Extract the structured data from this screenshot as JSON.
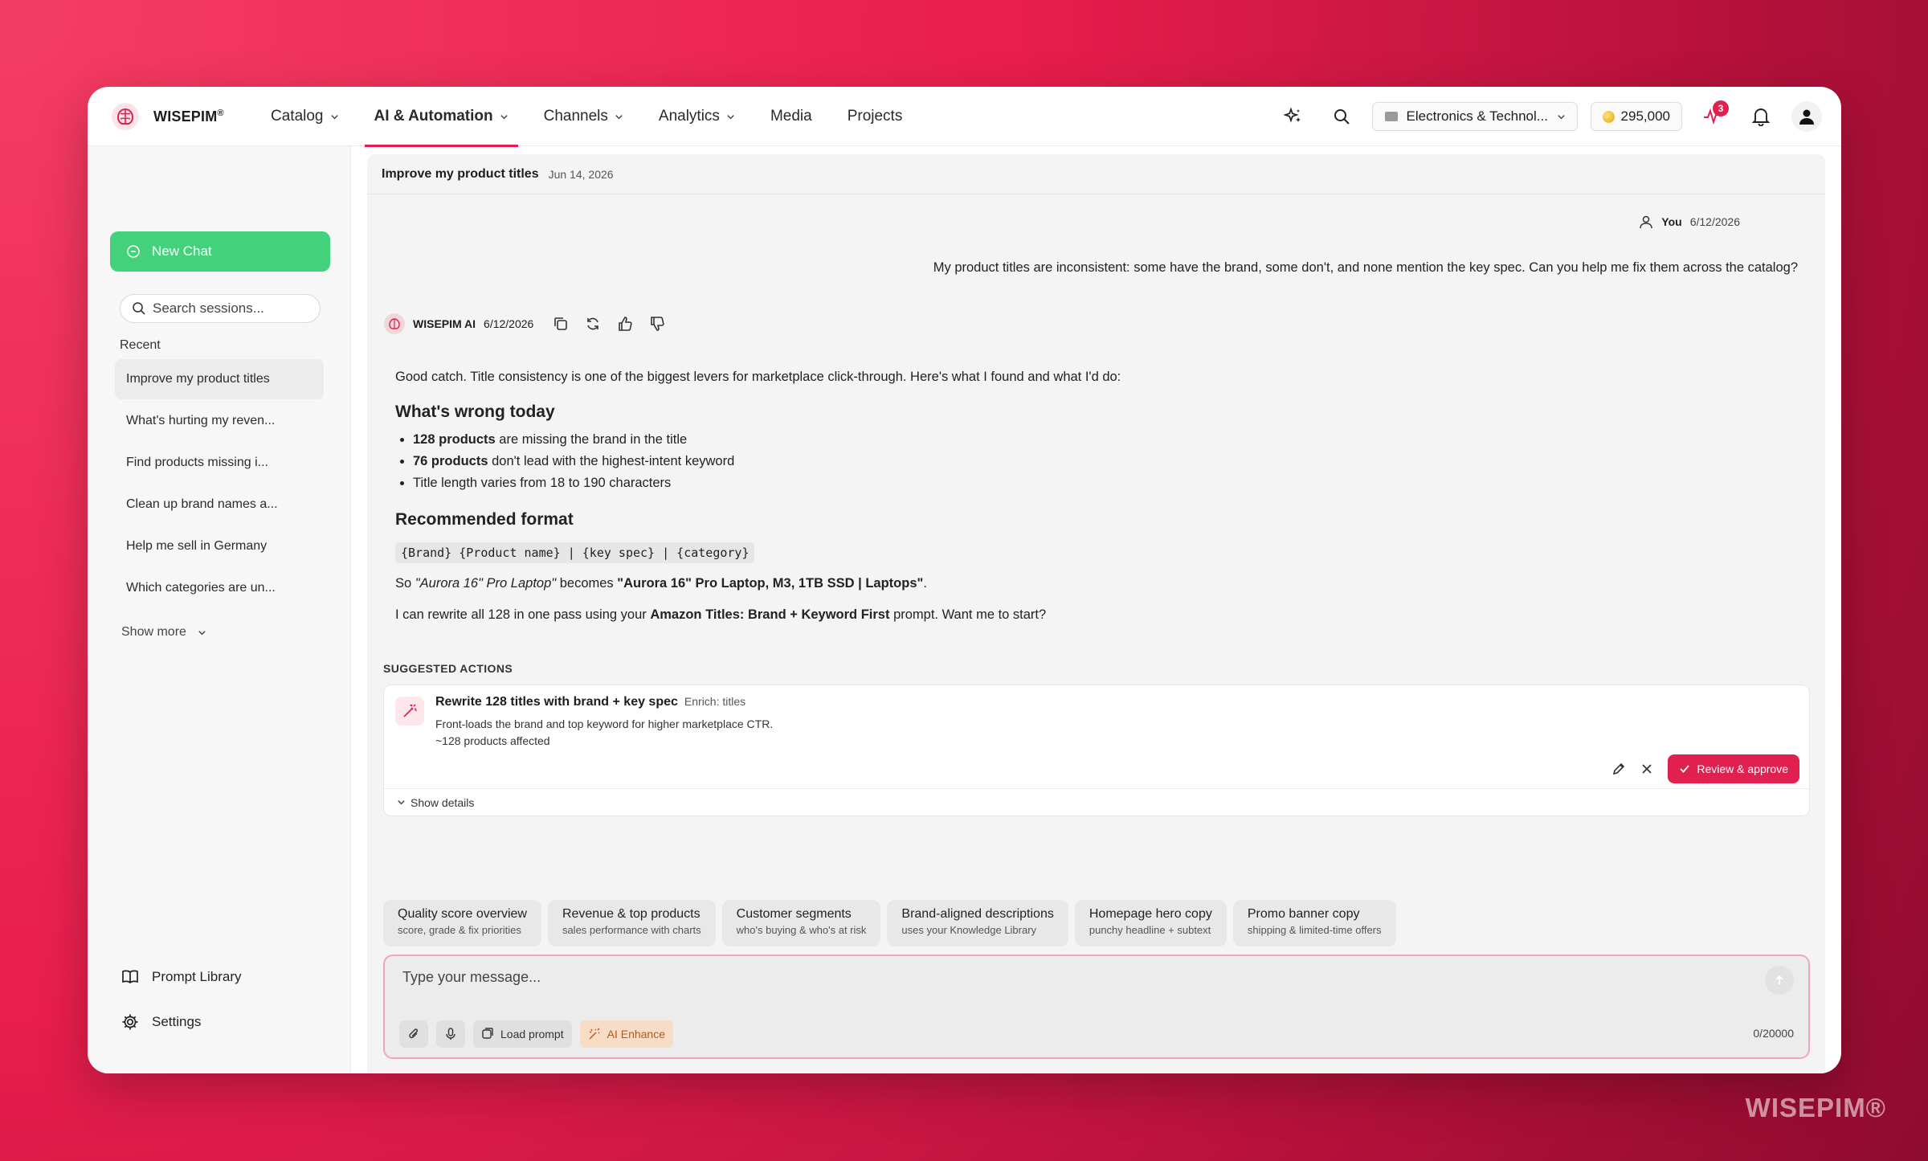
{
  "brand": {
    "name": "WISEPIM",
    "mark": "®",
    "watermark": "WISEPIM®"
  },
  "nav": [
    {
      "label": "Catalog",
      "dropdown": true
    },
    {
      "label": "AI & Automation",
      "dropdown": true,
      "active": true
    },
    {
      "label": "Channels",
      "dropdown": true
    },
    {
      "label": "Analytics",
      "dropdown": true
    },
    {
      "label": "Media",
      "dropdown": false
    },
    {
      "label": "Projects",
      "dropdown": false
    }
  ],
  "header": {
    "store_label": "Electronics & Technol...",
    "credits": "295,000",
    "activity_badge": "3"
  },
  "sidebar": {
    "new_chat": "New Chat",
    "search_placeholder": "Search sessions...",
    "recent_label": "Recent",
    "sessions": [
      "Improve my product titles",
      "What's hurting my reven...",
      "Find products missing i...",
      "Clean up brand names a...",
      "Help me sell in Germany",
      "Which categories are un..."
    ],
    "show_more": "Show more",
    "prompt_library": "Prompt Library",
    "settings": "Settings"
  },
  "chat": {
    "title": "Improve my product titles",
    "date": "Jun 14, 2026",
    "user": {
      "name": "You",
      "date": "6/12/2026",
      "message": "My product titles are inconsistent: some have the brand, some don't, and none mention the key spec. Can you help me fix them across the catalog?"
    },
    "ai": {
      "name": "WISEPIM AI",
      "date": "6/12/2026",
      "intro": "Good catch. Title consistency is one of the biggest levers for marketplace click-through. Here's what I found and what I'd do:",
      "h1": "What's wrong today",
      "bullets": [
        {
          "bold": "128 products",
          "text": " are missing the brand in the title"
        },
        {
          "bold": "76 products",
          "text": " don't lead with the highest-intent keyword"
        },
        {
          "bold": "",
          "text": "Title length varies from 18 to 190 characters"
        }
      ],
      "h2": "Recommended format",
      "format": "{Brand} {Product name} | {key spec} | {category}",
      "example_so": "So ",
      "example_from": "\"Aurora 16\" Pro Laptop\"",
      "example_becomes": " becomes ",
      "example_to": "\"Aurora 16\" Pro Laptop, M3, 1TB SSD | Laptops\"",
      "example_end": ".",
      "closing_pre": "I can rewrite all 128 in one pass using your ",
      "closing_bold": "Amazon Titles: Brand + Keyword First",
      "closing_post": " prompt. Want me to start?"
    }
  },
  "suggested": {
    "label": "SUGGESTED ACTIONS",
    "title": "Rewrite 128 titles with brand + key spec",
    "tag": "Enrich: titles",
    "desc": "Front-loads the brand and top keyword for higher marketplace CTR.",
    "affected": "~128 products affected",
    "approve": "Review & approve",
    "details": "Show details"
  },
  "chips": [
    {
      "title": "Quality score overview",
      "sub": "score, grade & fix priorities"
    },
    {
      "title": "Revenue & top products",
      "sub": "sales performance with charts"
    },
    {
      "title": "Customer segments",
      "sub": "who's buying & who's at risk"
    },
    {
      "title": "Brand-aligned descriptions",
      "sub": "uses your Knowledge Library"
    },
    {
      "title": "Homepage hero copy",
      "sub": "punchy headline + subtext"
    },
    {
      "title": "Promo banner copy",
      "sub": "shipping & limited-time offers"
    }
  ],
  "composer": {
    "placeholder": "Type your message...",
    "load_prompt": "Load prompt",
    "enhance": "AI Enhance",
    "counter": "0/20000"
  },
  "colors": {
    "accent": "#e0204f",
    "new_chat": "#43d17b"
  }
}
